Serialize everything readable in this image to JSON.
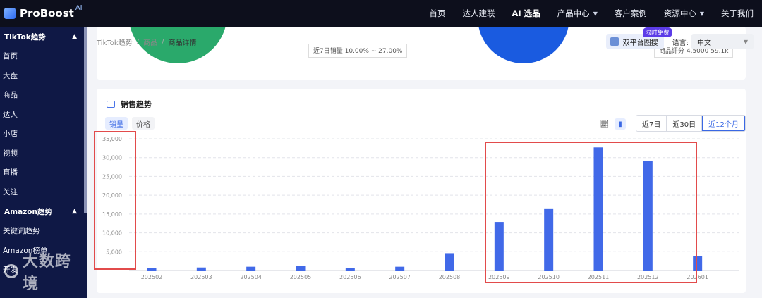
{
  "nav": {
    "brand": "ProBoost",
    "brand_suffix": "AI",
    "links": [
      {
        "label": "首页",
        "dropdown": false
      },
      {
        "label": "达人建联",
        "dropdown": false
      },
      {
        "label": "AI 选品",
        "dropdown": false
      },
      {
        "label": "产品中心",
        "dropdown": true
      },
      {
        "label": "客户案例",
        "dropdown": false
      },
      {
        "label": "资源中心",
        "dropdown": true
      },
      {
        "label": "关于我们",
        "dropdown": false
      }
    ]
  },
  "sidebar": {
    "group1": "TikTok趋势",
    "items1": [
      "首页",
      "大盘",
      "商品",
      "达人",
      "小店",
      "视频",
      "直播",
      "关注"
    ],
    "group2": "Amazon趋势",
    "items2": [
      "关键词趋势",
      "Amazon榜单",
      "开发"
    ],
    "watermark": "大数跨境"
  },
  "breadcrumb": [
    "TikTok趋势",
    "商品",
    "商品详情"
  ],
  "top_right": {
    "dual_search": "双平台图搜",
    "badge": "限时免费",
    "lang_label": "语言:",
    "lang_value": "中文"
  },
  "top_card": {
    "stat_a": "近7日销量   10.00% ~ 27.00%",
    "stat_b": "商品评分   4.5000   59.1k"
  },
  "sales": {
    "title": "销售趋势",
    "subtabs": [
      "销量",
      "价格"
    ],
    "ranges": [
      "近7日",
      "近30日",
      "近12个月"
    ]
  },
  "chart_data": {
    "type": "bar",
    "categories": [
      "202502",
      "202503",
      "202504",
      "202505",
      "202506",
      "202507",
      "202508",
      "202509",
      "202510",
      "202511",
      "202512",
      "202601"
    ],
    "values": [
      600,
      800,
      1000,
      1300,
      600,
      1000,
      4600,
      12900,
      16500,
      32700,
      29200,
      3800
    ],
    "ylim": [
      0,
      35000
    ],
    "yticks": [
      "5,000",
      "10,000",
      "15,000",
      "20,000",
      "25,000",
      "30,000",
      "35,000"
    ],
    "ytick_values": [
      5000,
      10000,
      15000,
      20000,
      25000,
      30000,
      35000
    ],
    "bar_color": "#4169e8",
    "grid": true
  }
}
